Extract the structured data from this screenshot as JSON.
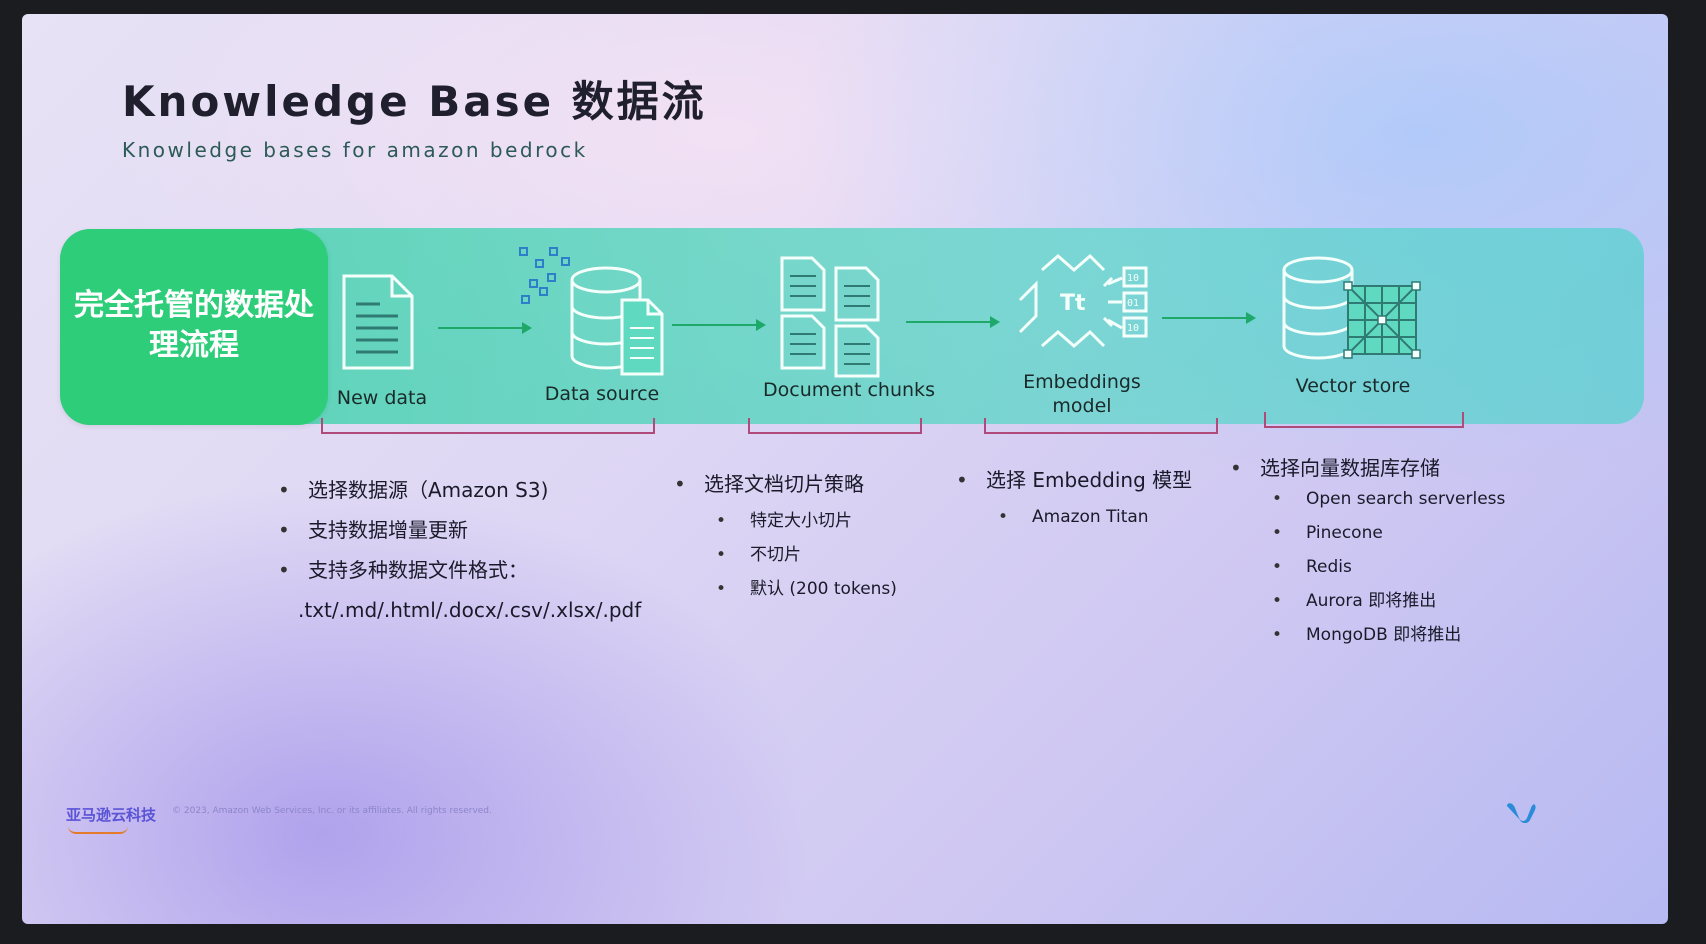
{
  "title": "Knowledge Base 数据流",
  "subtitle": "Knowledge bases for amazon bedrock",
  "managed_label": "完全托管的数据处理流程",
  "stages": [
    {
      "label": "New data",
      "icon": "document-icon"
    },
    {
      "label": "Data source",
      "icon": "database-documents-icon"
    },
    {
      "label": "Document chunks",
      "icon": "document-chunks-icon"
    },
    {
      "label": "Embeddings model",
      "icon": "embeddings-model-icon"
    },
    {
      "label": "Vector store",
      "icon": "vector-store-icon"
    }
  ],
  "bullets": {
    "data_source": {
      "items": [
        "选择数据源（Amazon S3)",
        "支持数据增量更新",
        "支持多种数据文件格式："
      ],
      "formats": ".txt/.md/.html/.docx/.csv/.xlsx/.pdf"
    },
    "chunking": {
      "main": "选择文档切片策略",
      "sub": [
        "特定大小切片",
        "不切片",
        "默认 (200 tokens)"
      ]
    },
    "embedding": {
      "main": "选择 Embedding 模型",
      "sub": [
        "Amazon Titan"
      ]
    },
    "vector": {
      "main": "选择向量数据库存储",
      "sub": [
        "Open search serverless",
        "Pinecone",
        "Redis",
        "Aurora 即将推出",
        "MongoDB 即将推出"
      ]
    }
  },
  "footer": {
    "logo": "亚马逊云科技",
    "copyright": "© 2023, Amazon Web Services, Inc. or its affiliates. All rights reserved."
  },
  "colors": {
    "accent_green": "#2ecd7a",
    "band_teal": "#4fd4b5",
    "arrow": "#1ea86a",
    "bracket": "#b04a7a"
  }
}
